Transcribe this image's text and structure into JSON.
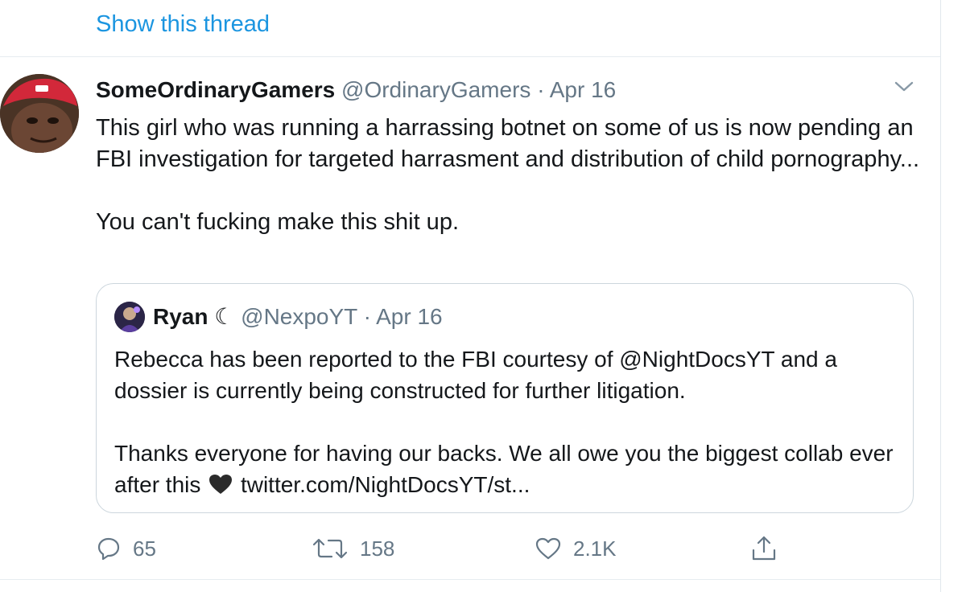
{
  "thread": {
    "show_thread_label": "Show this thread"
  },
  "tweet": {
    "display_name": "SomeOrdinaryGamers",
    "handle": "@OrdinaryGamers",
    "separator": "·",
    "date": "Apr 16",
    "text_paragraphs": [
      "This girl who was running a harrassing botnet on some of us is now pending an FBI investigation for targeted harrasment and distribution of child pornography...",
      "You can't fucking make this shit up."
    ],
    "avatar_icon": "avatar-red-cap",
    "menu_icon": "chevron-down-icon"
  },
  "quote": {
    "display_name": "Ryan",
    "name_emoji": "☾",
    "handle": "@NexpoYT",
    "separator": "·",
    "date": "Apr 16",
    "paragraph1": "Rebecca has been reported to the FBI courtesy of @NightDocsYT and a dossier is currently being constructed for further litigation.",
    "paragraph2_before": "Thanks everyone for having our backs. We all owe you the biggest collab ever after this",
    "paragraph2_emoji_icon": "black-heart-icon",
    "paragraph2_link": "twitter.com/NightDocsYT/st..."
  },
  "actions": {
    "reply_count": "65",
    "retweet_count": "158",
    "like_count": "2.1K",
    "reply_icon": "reply-icon",
    "retweet_icon": "retweet-icon",
    "like_icon": "heart-icon",
    "share_icon": "share-icon"
  },
  "colors": {
    "link": "#1b95e0",
    "secondary_text": "#657786",
    "primary_text": "#14171a",
    "border": "#ccd6dd"
  }
}
